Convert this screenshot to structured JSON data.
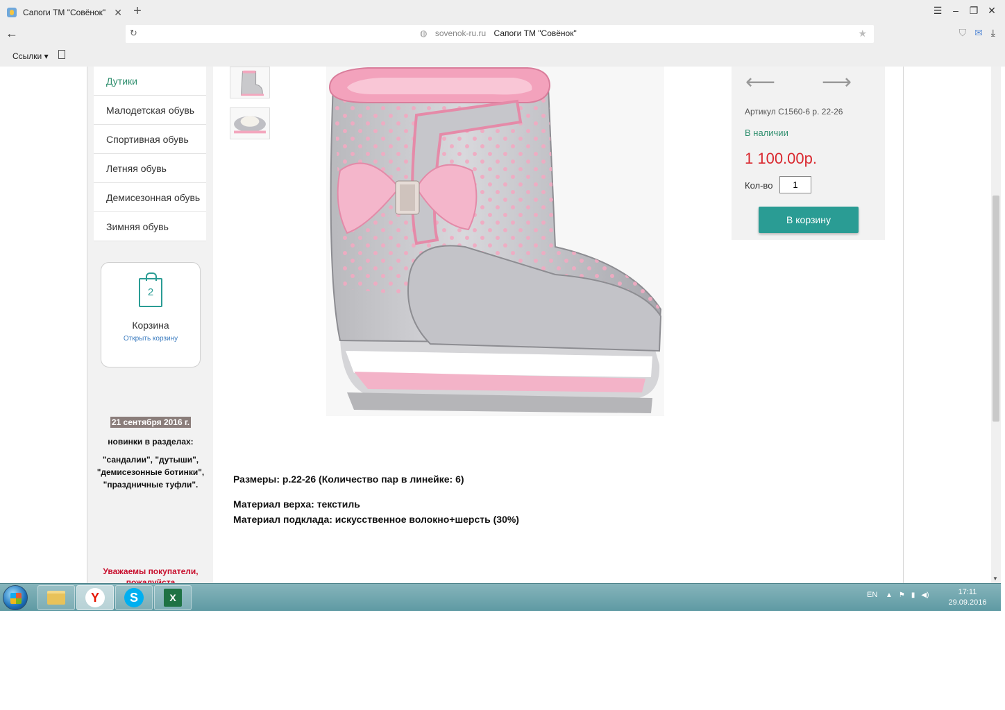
{
  "browser": {
    "tab_title": "Сапоги ТМ \"Совёнок\"",
    "tab_close": "✕",
    "new_tab": "+",
    "back": "←",
    "reload": "↻",
    "domain": "sovenok-ru.ru",
    "page_title": "Сапоги ТМ \"Совёнок\"",
    "bookmarks_label": "Ссылки ▾"
  },
  "sidebar": {
    "categories": [
      {
        "label": "Дутики"
      },
      {
        "label": "Малодетская обувь"
      },
      {
        "label": "Спортивная обувь"
      },
      {
        "label": "Летняя обувь"
      },
      {
        "label": "Демисезонная обувь"
      },
      {
        "label": "Зимняя обувь"
      }
    ],
    "cart": {
      "count": "2",
      "title": "Корзина",
      "open_link": "Открыть корзину"
    },
    "news": {
      "date": "21 сентября 2016 г.",
      "line1": "новинки в разделах:",
      "line2": "\"сандалии\", \"дутыши\", \"демисезонные ботинки\", \"праздничные туфли\"."
    },
    "notice": "Уважаемы покупатели, пожалуйста"
  },
  "product": {
    "sku": "Артикул С1560-6 р. 22-26",
    "stock": "В наличии",
    "price": "1 100.00р.",
    "qty_label": "Кол-во",
    "qty_value": "1",
    "add_to_cart": "В корзину",
    "prev_arrow": "⟵",
    "next_arrow": "⟶",
    "sizes": "Размеры: р.22-26 (Количество пар в линейке: 6)",
    "material_top": "Материал верха: текстиль",
    "material_lining": "Материал подклада: искусственное волокно+шерсть (30%)"
  },
  "taskbar": {
    "lang": "EN",
    "time": "17:11",
    "date": "29.09.2016"
  },
  "colors": {
    "accent": "#2a9c94",
    "price": "#d9272e",
    "stock": "#2f8f6e",
    "notice": "#c8102e"
  }
}
